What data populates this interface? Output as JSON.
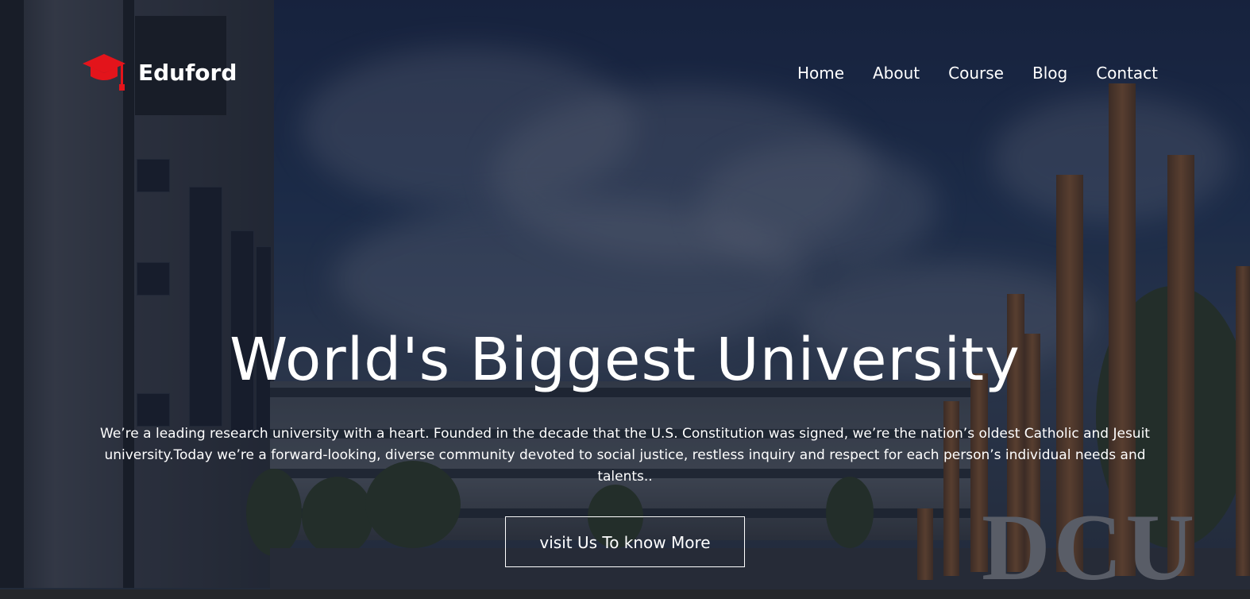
{
  "brand": {
    "name": "Eduford",
    "logo_icon": "graduation-cap-icon",
    "logo_color": "#e3141b"
  },
  "nav": {
    "items": [
      "Home",
      "About",
      "Course",
      "Blog",
      "Contact"
    ]
  },
  "hero": {
    "title": "World's Biggest University",
    "description": "We’re a leading research university with a heart. Founded in the decade that the U.S. Constitution was signed, we’re the nation’s oldest Catholic and Jesuit university.Today we’re a forward-looking, diverse community devoted to social justice, restless inquiry and respect for each person’s individual needs and talents..",
    "cta_label": "visit Us To know More",
    "sign_text": "DCU"
  },
  "colors": {
    "text": "#ffffff",
    "accent": "#e3141b",
    "overlay": "#121828"
  }
}
